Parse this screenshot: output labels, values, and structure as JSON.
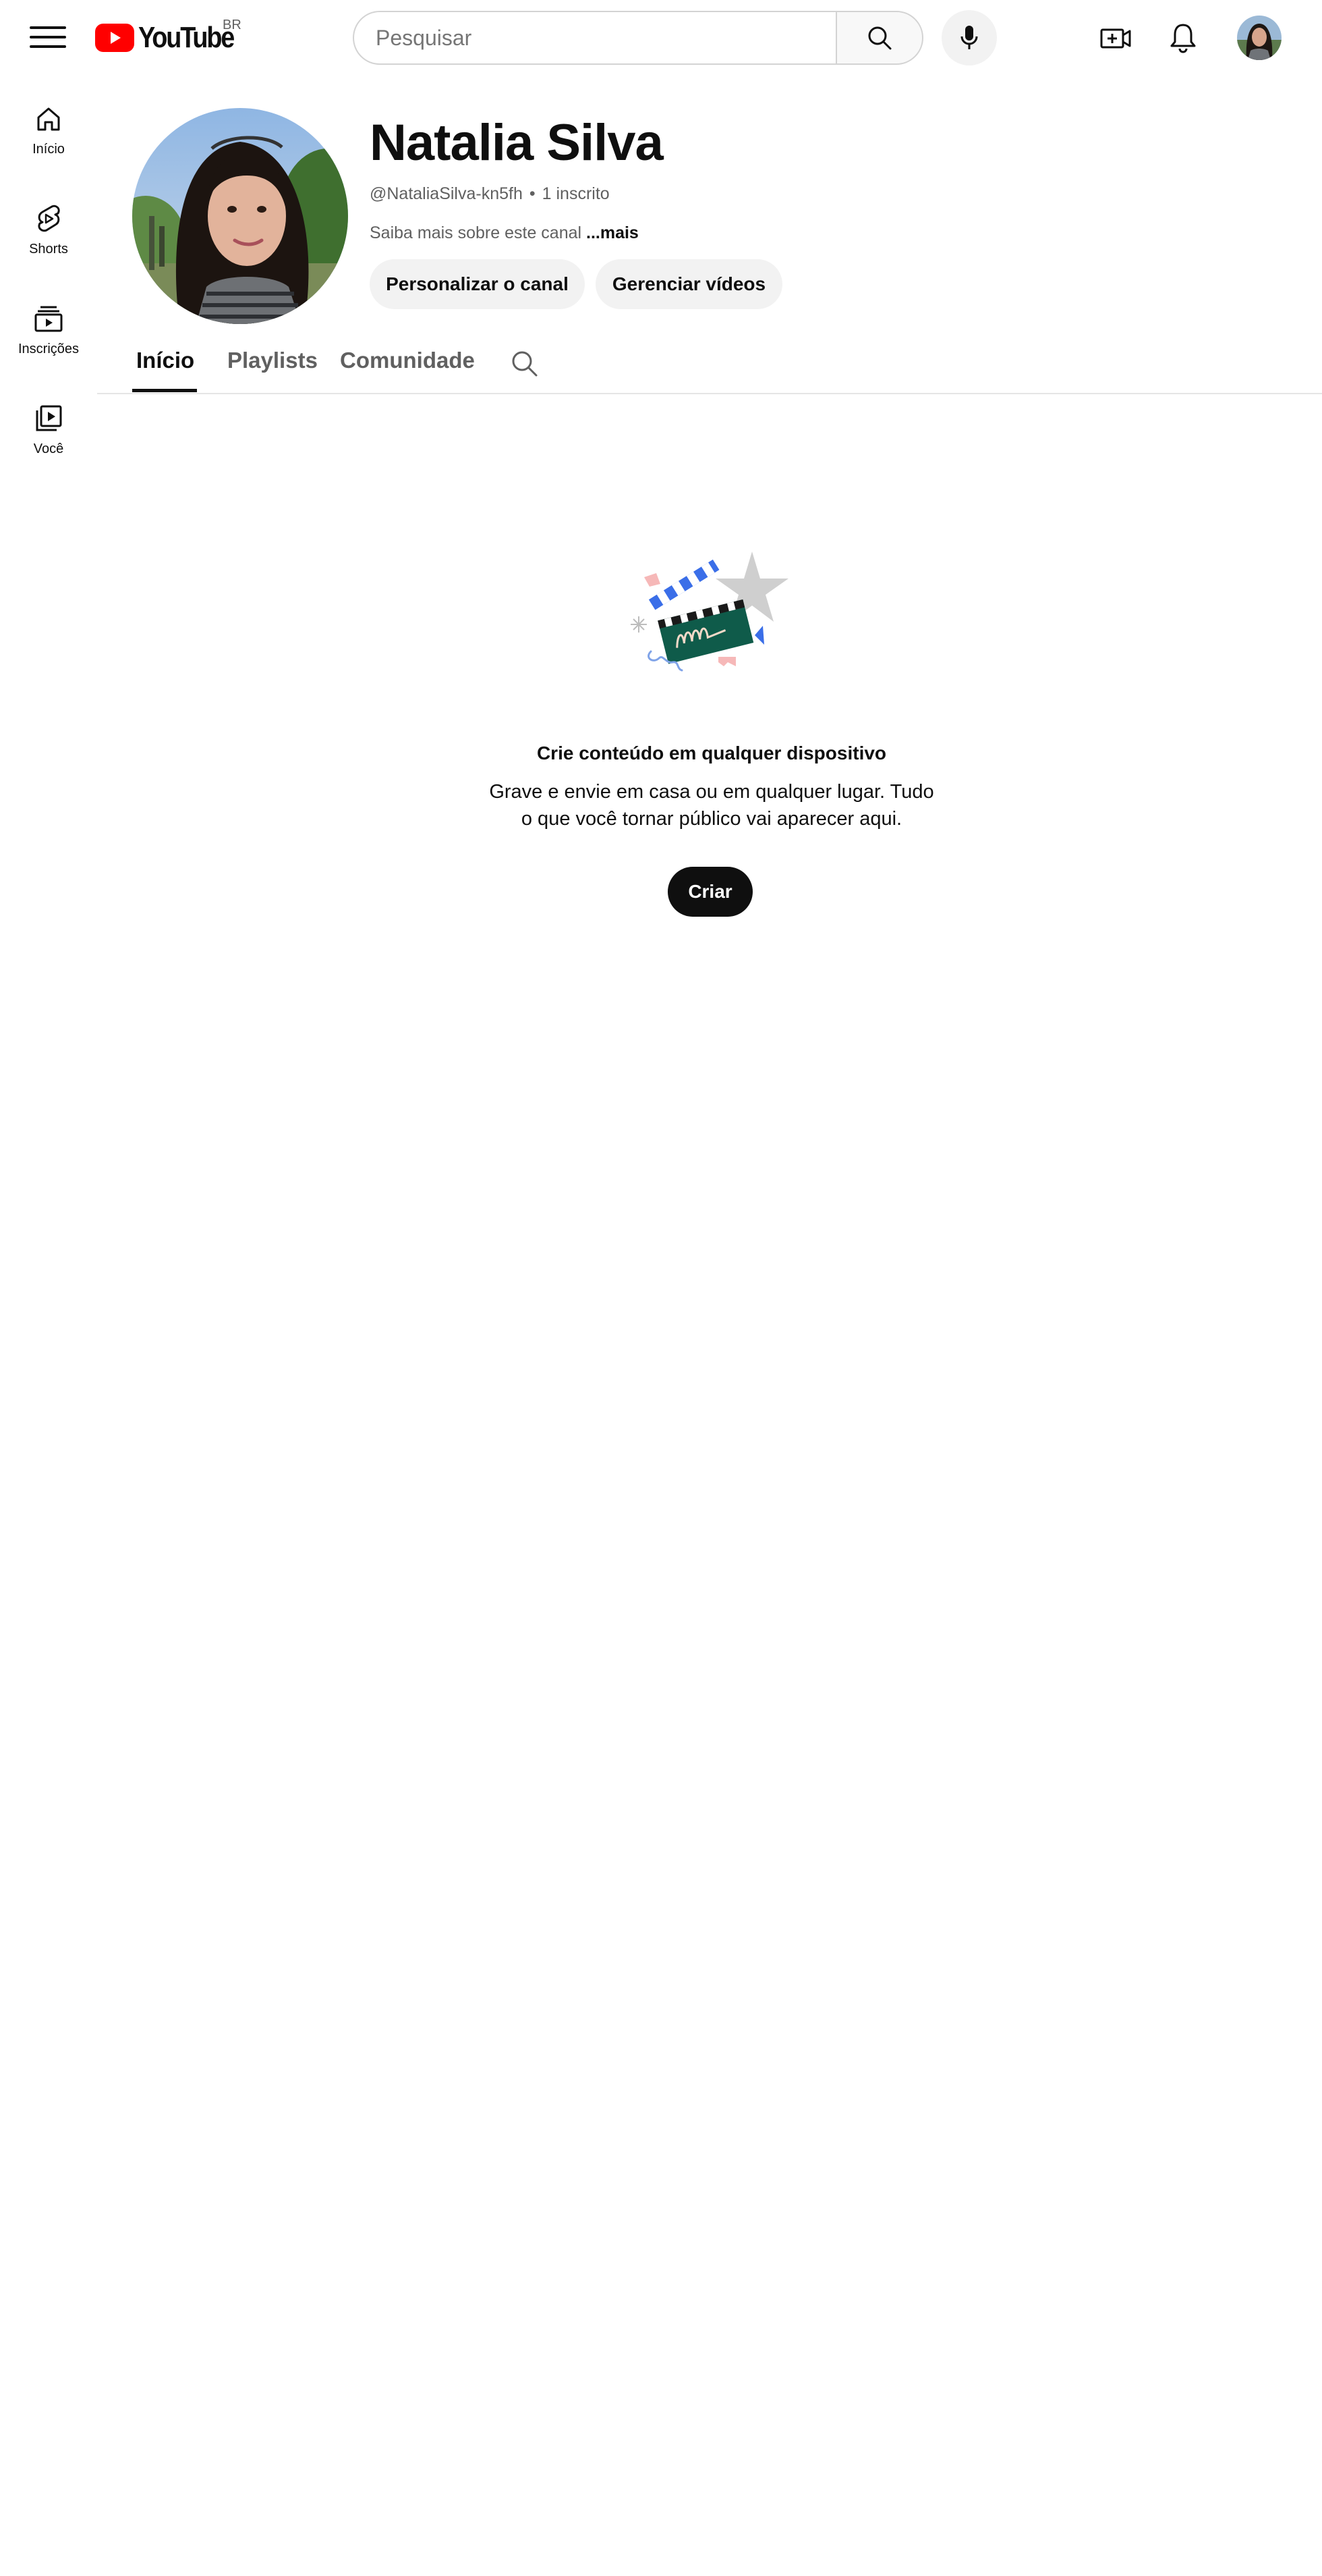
{
  "topbar": {
    "logo_text": "YouTube",
    "country_code": "BR",
    "search_placeholder": "Pesquisar",
    "search_value": ""
  },
  "guide": {
    "items": [
      {
        "label": "Início",
        "icon": "home-icon"
      },
      {
        "label": "Shorts",
        "icon": "shorts-icon"
      },
      {
        "label": "Inscrições",
        "icon": "subscriptions-icon"
      },
      {
        "label": "Você",
        "icon": "you-library-icon"
      }
    ]
  },
  "channel": {
    "name": "Natalia Silva",
    "handle": "@NataliaSilva-kn5fh",
    "separator": "•",
    "subscribers": "1 inscrito",
    "about_text": "Saiba mais sobre este canal",
    "about_more": "...mais",
    "customize_label": "Personalizar o canal",
    "manage_label": "Gerenciar vídeos"
  },
  "tabs": [
    {
      "label": "Início",
      "active": true
    },
    {
      "label": "Playlists",
      "active": false
    },
    {
      "label": "Comunidade",
      "active": false
    }
  ],
  "empty_state": {
    "title": "Crie conteúdo em qualquer dispositivo",
    "line1": "Grave e envie em casa ou em qualquer lugar. Tudo",
    "line2": "o que você tornar público vai aparecer aqui.",
    "button_label": "Criar",
    "illustration": "clapperboard-illustration"
  },
  "colors": {
    "brand_red": "#ff0000",
    "text_primary": "#0f0f0f",
    "text_secondary": "#606060",
    "pill_bg": "#f2f2f2",
    "divider": "#e5e5e5"
  }
}
